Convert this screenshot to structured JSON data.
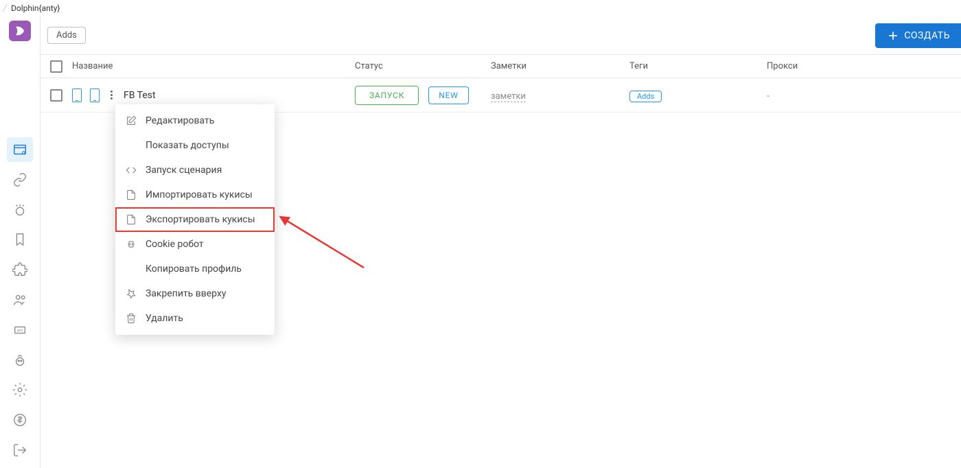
{
  "window_title": "Dolphin{anty}",
  "topbar": {
    "tag_chip": "Adds",
    "create_button": "СОЗДАТЬ"
  },
  "columns": {
    "name": "Название",
    "status": "Статус",
    "notes": "Заметки",
    "tags": "Теги",
    "proxy": "Прокси"
  },
  "row": {
    "name": "FB Test",
    "launch": "ЗАПУСК",
    "status_badge": "NEW",
    "notes": "заметки",
    "tag": "Adds",
    "proxy": "-"
  },
  "context_menu": {
    "items": [
      {
        "label": "Редактировать",
        "icon": "edit"
      },
      {
        "label": "Показать доступы",
        "icon": ""
      },
      {
        "label": "Запуск сценария",
        "icon": "code"
      },
      {
        "label": "Импортировать кукисы",
        "icon": "file"
      },
      {
        "label": "Экспортировать кукисы",
        "icon": "file",
        "highlighted": true
      },
      {
        "label": "Cookie робот",
        "icon": "robot"
      },
      {
        "label": "Копировать профиль",
        "icon": ""
      },
      {
        "label": "Закрепить вверху",
        "icon": "pin"
      },
      {
        "label": "Удалить",
        "icon": "trash"
      }
    ]
  }
}
